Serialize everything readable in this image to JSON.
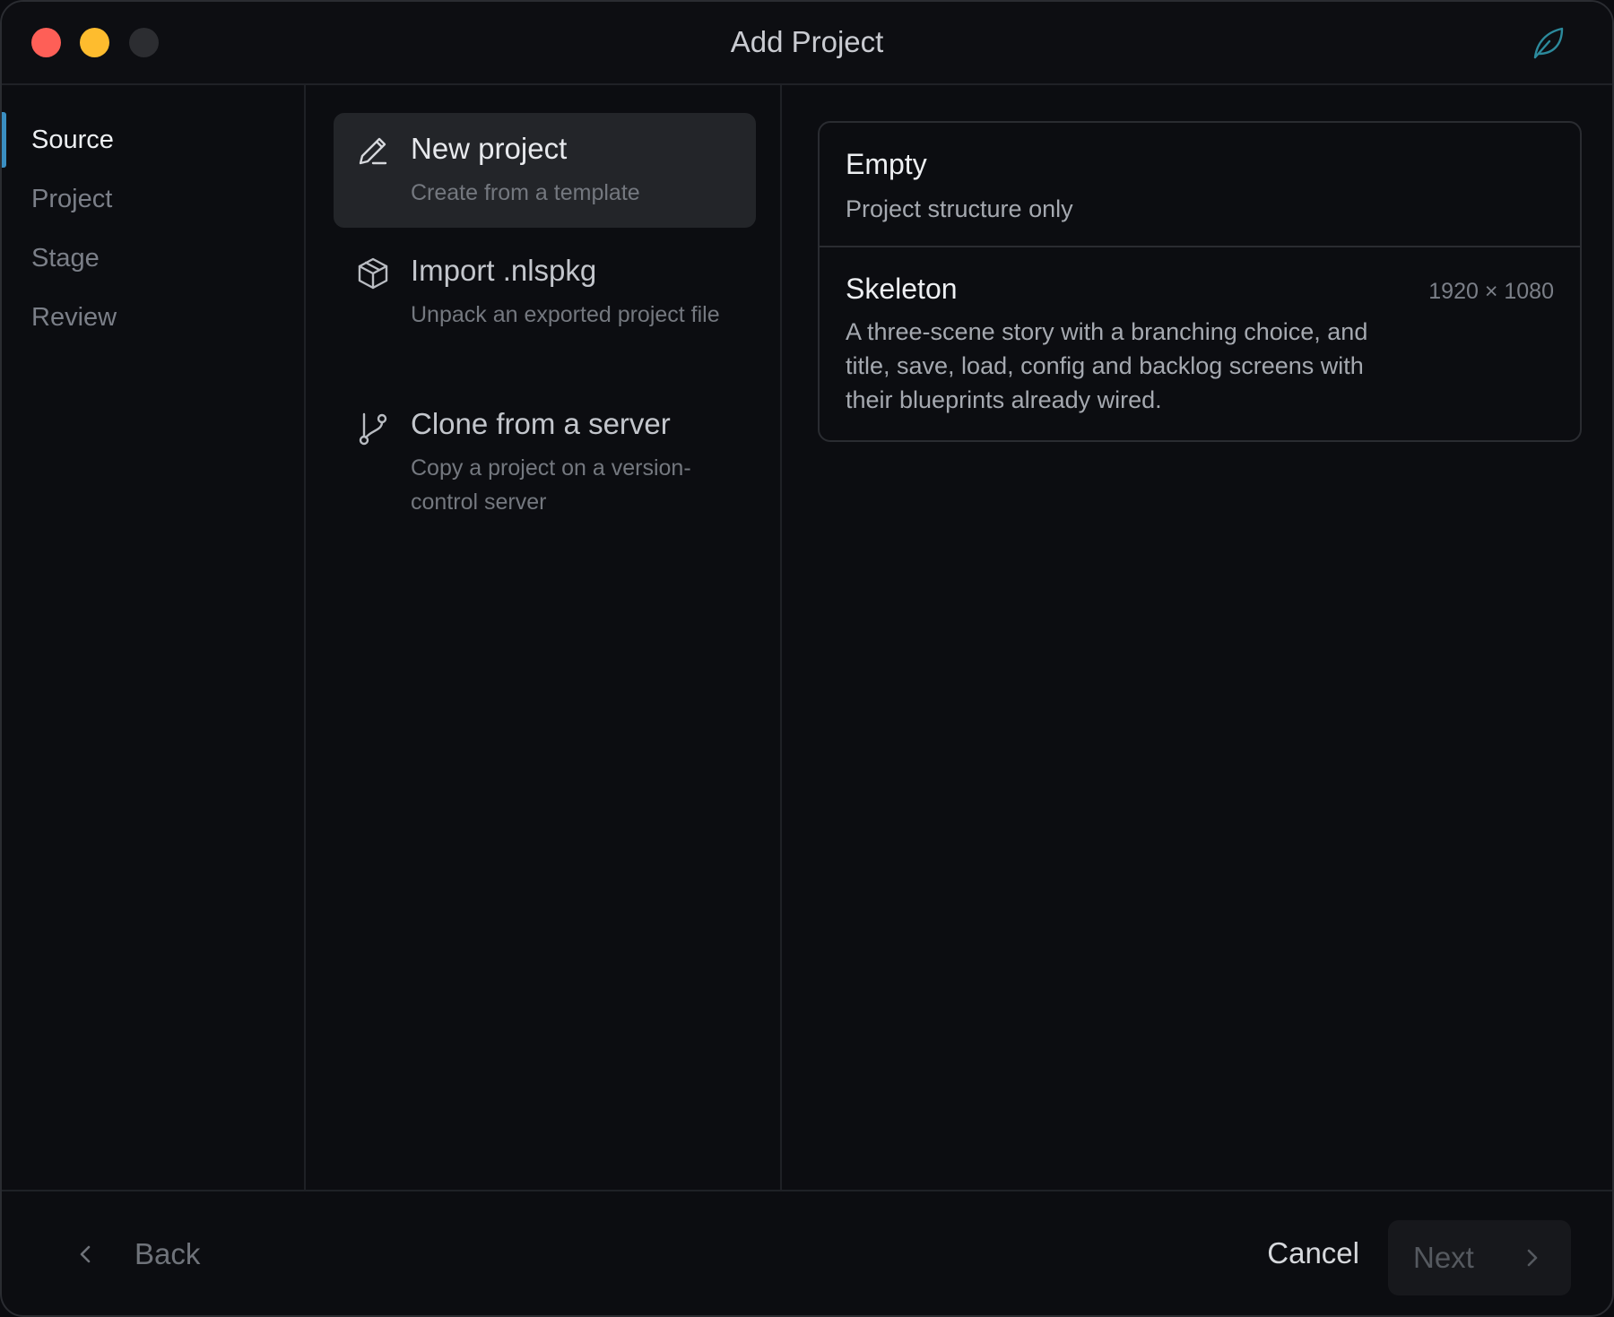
{
  "window": {
    "title": "Add Project"
  },
  "sidebar": {
    "items": [
      {
        "label": "Source",
        "active": true
      },
      {
        "label": "Project",
        "active": false
      },
      {
        "label": "Stage",
        "active": false
      },
      {
        "label": "Review",
        "active": false
      }
    ]
  },
  "sources": [
    {
      "title": "New project",
      "description": "Create from a template",
      "icon": "pencil-icon",
      "selected": true
    },
    {
      "title": "Import .nlspkg",
      "description": "Unpack an exported project file",
      "icon": "package-icon",
      "selected": false
    },
    {
      "title": "Clone from a server",
      "description": "Copy a project on a version-control server",
      "icon": "git-branch-icon",
      "selected": false
    }
  ],
  "templates": [
    {
      "name": "Empty",
      "description": "Project structure only",
      "resolution": ""
    },
    {
      "name": "Skeleton",
      "description": "A three-scene story with a branching choice, and title, save, load, config and backlog screens with their blueprints already wired.",
      "resolution": "1920 × 1080"
    }
  ],
  "footer": {
    "back_label": "Back",
    "cancel_label": "Cancel",
    "next_label": "Next"
  },
  "colors": {
    "accent": "#3a8ec2",
    "close": "#fe5f57",
    "minimize": "#febc2e",
    "background": "#0c0d11"
  }
}
